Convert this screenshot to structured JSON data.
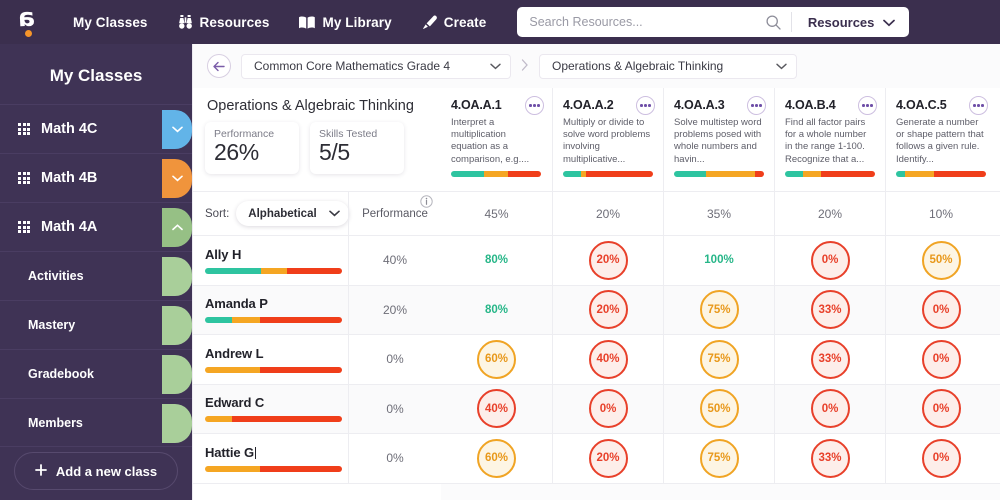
{
  "topnav": {
    "logo_name": "brand-logo",
    "items": [
      {
        "label": "My Classes",
        "icon": ""
      },
      {
        "label": "Resources",
        "icon": "binoculars-icon"
      },
      {
        "label": "My Library",
        "icon": "book-icon"
      },
      {
        "label": "Create",
        "icon": "pen-icon"
      }
    ],
    "search": {
      "value": "",
      "placeholder": "Search Resources..."
    },
    "scope_select": "Resources"
  },
  "sidebar": {
    "title": "My Classes",
    "classes": [
      {
        "label": "Math 4C",
        "tab_color": "#62b4e8",
        "expanded": false
      },
      {
        "label": "Math 4B",
        "tab_color": "#f0943c",
        "expanded": false
      },
      {
        "label": "Math 4A",
        "tab_color": "#96c085",
        "expanded": true
      }
    ],
    "subitems": [
      {
        "label": "Activities",
        "tab_color": "#a9cf9a"
      },
      {
        "label": "Mastery",
        "tab_color": "#a9cf9a"
      },
      {
        "label": "Gradebook",
        "tab_color": "#a9cf9a"
      },
      {
        "label": "Members",
        "tab_color": "#a9cf9a"
      }
    ],
    "add_class": "Add a new class"
  },
  "breadcrumb": {
    "back": "back-arrow",
    "curriculum": "Common Core Mathematics Grade 4",
    "domain": "Operations & Algebraic Thinking"
  },
  "summary": {
    "title": "Operations & Algebraic Thinking",
    "cards": [
      {
        "key": "Performance",
        "value": "26%"
      },
      {
        "key": "Skills Tested",
        "value": "5/5"
      }
    ]
  },
  "sortbar": {
    "sort_label": "Sort:",
    "sort_value": "Alphabetical",
    "performance_label": "Performance"
  },
  "standards": [
    {
      "code": "4.OA.A.1",
      "description": "Interpret a multiplication equation as a comparison, e.g....",
      "percent": "45%",
      "bar": [
        {
          "color": "#2ec4a0",
          "pct": 37
        },
        {
          "color": "#f5a623",
          "pct": 26
        },
        {
          "color": "#f03e1a",
          "pct": 37
        }
      ]
    },
    {
      "code": "4.OA.A.2",
      "description": "Multiply or divide to solve word problems involving multiplicative...",
      "percent": "20%",
      "bar": [
        {
          "color": "#2ec4a0",
          "pct": 20
        },
        {
          "color": "#f5a623",
          "pct": 5
        },
        {
          "color": "#f03e1a",
          "pct": 75
        }
      ]
    },
    {
      "code": "4.OA.A.3",
      "description": "Solve multistep word problems posed with whole numbers and havin...",
      "percent": "35%",
      "bar": [
        {
          "color": "#2ec4a0",
          "pct": 36
        },
        {
          "color": "#f5a623",
          "pct": 54
        },
        {
          "color": "#f03e1a",
          "pct": 10
        }
      ]
    },
    {
      "code": "4.OA.B.4",
      "description": "Find all factor pairs for a whole number in the range 1-100. Recognize that a...",
      "percent": "20%",
      "bar": [
        {
          "color": "#2ec4a0",
          "pct": 20
        },
        {
          "color": "#f5a623",
          "pct": 20
        },
        {
          "color": "#f03e1a",
          "pct": 60
        }
      ]
    },
    {
      "code": "4.OA.C.5",
      "description": "Generate a number or shape pattern that follows a given rule. Identify...",
      "percent": "10%",
      "bar": [
        {
          "color": "#2ec4a0",
          "pct": 10
        },
        {
          "color": "#f5a623",
          "pct": 32
        },
        {
          "color": "#f03e1a",
          "pct": 58
        }
      ]
    }
  ],
  "students": [
    {
      "name": "Ally H",
      "performance": "40%",
      "bar": [
        {
          "color": "#2ec4a0",
          "pct": 41
        },
        {
          "color": "#f5a623",
          "pct": 19
        },
        {
          "color": "#f03e1a",
          "pct": 40
        }
      ],
      "scores": [
        {
          "value": "80%",
          "style": "green"
        },
        {
          "value": "20%",
          "style": "red"
        },
        {
          "value": "100%",
          "style": "green"
        },
        {
          "value": "0%",
          "style": "red"
        },
        {
          "value": "50%",
          "style": "amber"
        }
      ]
    },
    {
      "name": "Amanda P",
      "performance": "20%",
      "bar": [
        {
          "color": "#2ec4a0",
          "pct": 20
        },
        {
          "color": "#f5a623",
          "pct": 20
        },
        {
          "color": "#f03e1a",
          "pct": 60
        }
      ],
      "scores": [
        {
          "value": "80%",
          "style": "green"
        },
        {
          "value": "20%",
          "style": "red"
        },
        {
          "value": "75%",
          "style": "amber"
        },
        {
          "value": "33%",
          "style": "red"
        },
        {
          "value": "0%",
          "style": "red"
        }
      ]
    },
    {
      "name": "Andrew L",
      "performance": "0%",
      "bar": [
        {
          "color": "#f5a623",
          "pct": 40
        },
        {
          "color": "#f03e1a",
          "pct": 60
        }
      ],
      "scores": [
        {
          "value": "60%",
          "style": "amber"
        },
        {
          "value": "40%",
          "style": "red"
        },
        {
          "value": "75%",
          "style": "amber"
        },
        {
          "value": "33%",
          "style": "red"
        },
        {
          "value": "0%",
          "style": "red"
        }
      ]
    },
    {
      "name": "Edward C",
      "performance": "0%",
      "bar": [
        {
          "color": "#f5a623",
          "pct": 20
        },
        {
          "color": "#f03e1a",
          "pct": 80
        }
      ],
      "scores": [
        {
          "value": "40%",
          "style": "red"
        },
        {
          "value": "0%",
          "style": "red"
        },
        {
          "value": "50%",
          "style": "amber"
        },
        {
          "value": "0%",
          "style": "red"
        },
        {
          "value": "0%",
          "style": "red"
        }
      ]
    },
    {
      "name": "Hattie G",
      "performance": "0%",
      "bar": [
        {
          "color": "#f5a623",
          "pct": 40
        },
        {
          "color": "#f03e1a",
          "pct": 60
        }
      ],
      "scores": [
        {
          "value": "60%",
          "style": "amber"
        },
        {
          "value": "20%",
          "style": "red"
        },
        {
          "value": "75%",
          "style": "amber"
        },
        {
          "value": "33%",
          "style": "red"
        },
        {
          "value": "0%",
          "style": "red"
        }
      ]
    }
  ],
  "colors": {
    "nav_bg": "#3b2f4e",
    "sidebar_bg": "#3f3355",
    "accent_orange": "#f5952a",
    "mastery_green": "#2ec4a0",
    "mastery_amber": "#f5a623",
    "mastery_red": "#f03e1a",
    "purple_accent": "#6f4fa8"
  }
}
